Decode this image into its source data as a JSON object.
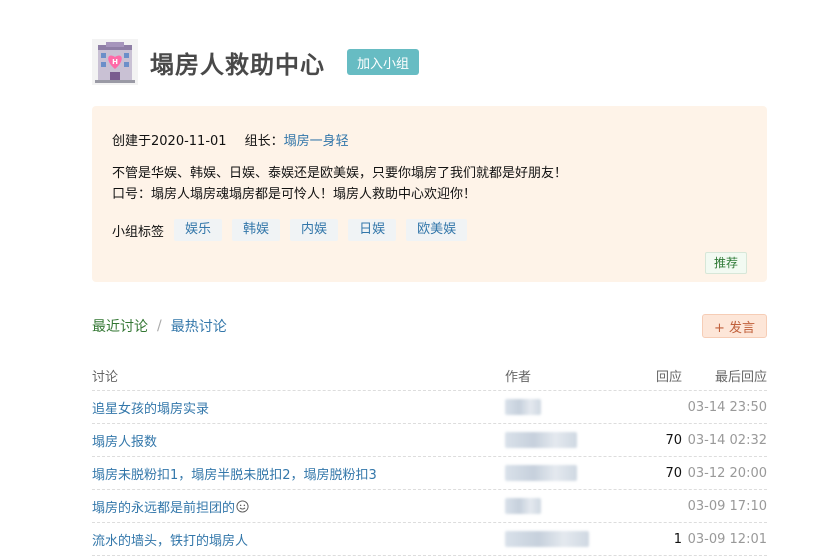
{
  "group": {
    "title": "塌房人救助中心",
    "join_label": "加入小组"
  },
  "info": {
    "created_label": "创建于2020-11-01",
    "leader_prefix": "组长：",
    "leader_name": "塌房一身轻",
    "description_line1": "不管是华娱、韩娱、日娱、泰娱还是欧美娱，只要你塌房了我们就都是好朋友！",
    "description_line2": "口号：塌房人塌房魂塌房都是可怜人！塌房人救助中心欢迎你！",
    "tags_label": "小组标签",
    "tags": [
      "娱乐",
      "韩娱",
      "内娱",
      "日娱",
      "欧美娱"
    ],
    "recommend_label": "推荐"
  },
  "tabs": {
    "recent": "最近讨论",
    "divider": "/",
    "hot": "最热讨论"
  },
  "post_button": {
    "label": "+ 发言"
  },
  "table": {
    "headers": [
      "讨论",
      "作者",
      "回应",
      "最后回应"
    ],
    "rows": [
      {
        "title": "追星女孩的塌房实录",
        "replies": "",
        "last": "03-14 23:50",
        "author_blur_width": 36
      },
      {
        "title": "塌房人报数",
        "replies": "70",
        "last": "03-14 02:32",
        "author_blur_width": 72
      },
      {
        "title": "塌房未脱粉扣1，塌房半脱未脱扣2，塌房脱粉扣3",
        "replies": "70",
        "last": "03-12 20:00",
        "author_blur_width": 72
      },
      {
        "title": "塌房的永远都是前担团的",
        "replies": "",
        "last": "03-09 17:10",
        "author_blur_width": 36
      },
      {
        "title": "流水的墙头，铁打的塌房人",
        "replies": "1",
        "last": "03-09 12:01",
        "author_blur_width": 84
      }
    ]
  },
  "colors": {
    "accent_green": "#337733",
    "link_blue": "#3377aa",
    "join_teal": "#67bcc3",
    "panel_bg": "#fef3e8"
  }
}
